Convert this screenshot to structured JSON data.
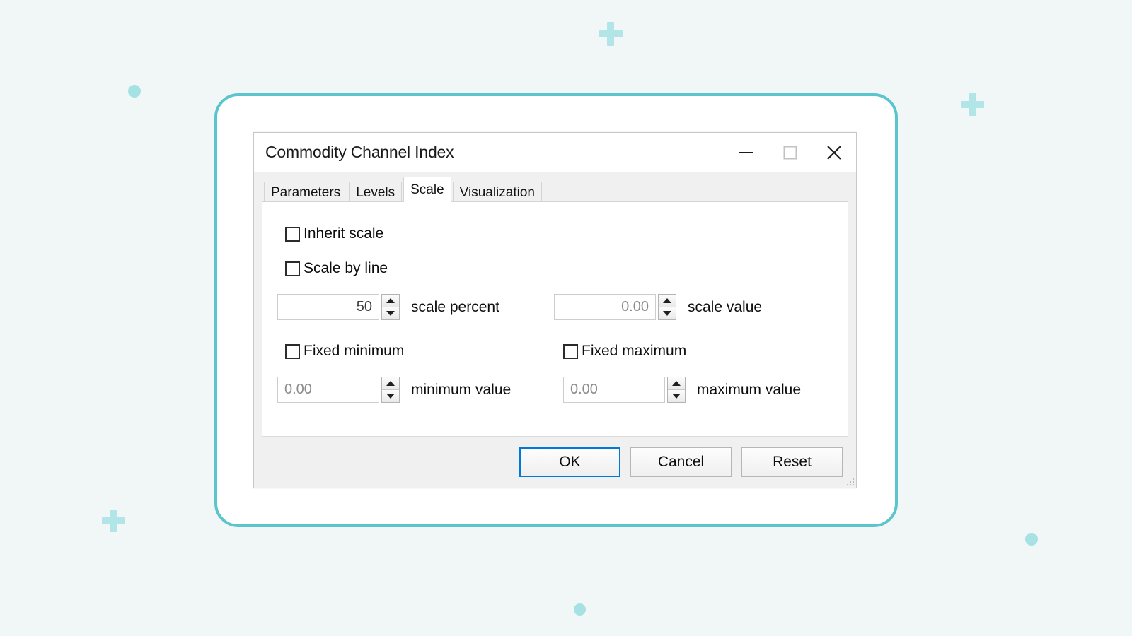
{
  "background": {
    "color": "#f1f7f7",
    "accent": "#5cc4cd",
    "decor_color": "#b2e5e7"
  },
  "card": {
    "border_color": "#5cc4cd"
  },
  "dialog": {
    "title": "Commodity Channel Index",
    "window_controls": [
      {
        "name": "minimize",
        "glyph": "minimize-icon",
        "enabled": true
      },
      {
        "name": "maximize",
        "glyph": "maximize-icon",
        "enabled": false
      },
      {
        "name": "close",
        "glyph": "close-icon",
        "enabled": true
      }
    ],
    "tabs": [
      {
        "label": "Parameters",
        "active": false
      },
      {
        "label": "Levels",
        "active": false
      },
      {
        "label": "Scale",
        "active": true
      },
      {
        "label": "Visualization",
        "active": false
      }
    ],
    "scale_tab": {
      "inherit_scale": {
        "label": "Inherit scale",
        "checked": false
      },
      "scale_by_line": {
        "label": "Scale by line",
        "checked": false
      },
      "scale_percent": {
        "value": "50",
        "caption": "scale percent",
        "align": "right",
        "enabled": true
      },
      "scale_value": {
        "value": "0.00",
        "caption": "scale value",
        "align": "right",
        "enabled": false
      },
      "fixed_minimum": {
        "label": "Fixed minimum",
        "checked": false
      },
      "fixed_maximum": {
        "label": "Fixed maximum",
        "checked": false
      },
      "minimum_value": {
        "value": "0.00",
        "caption": "minimum value",
        "align": "left",
        "enabled": false
      },
      "maximum_value": {
        "value": "0.00",
        "caption": "maximum value",
        "align": "left",
        "enabled": false
      }
    },
    "footer": {
      "ok_label": "OK",
      "cancel_label": "Cancel",
      "reset_label": "Reset",
      "default_button": "OK",
      "focus_color": "#0078d7"
    }
  }
}
